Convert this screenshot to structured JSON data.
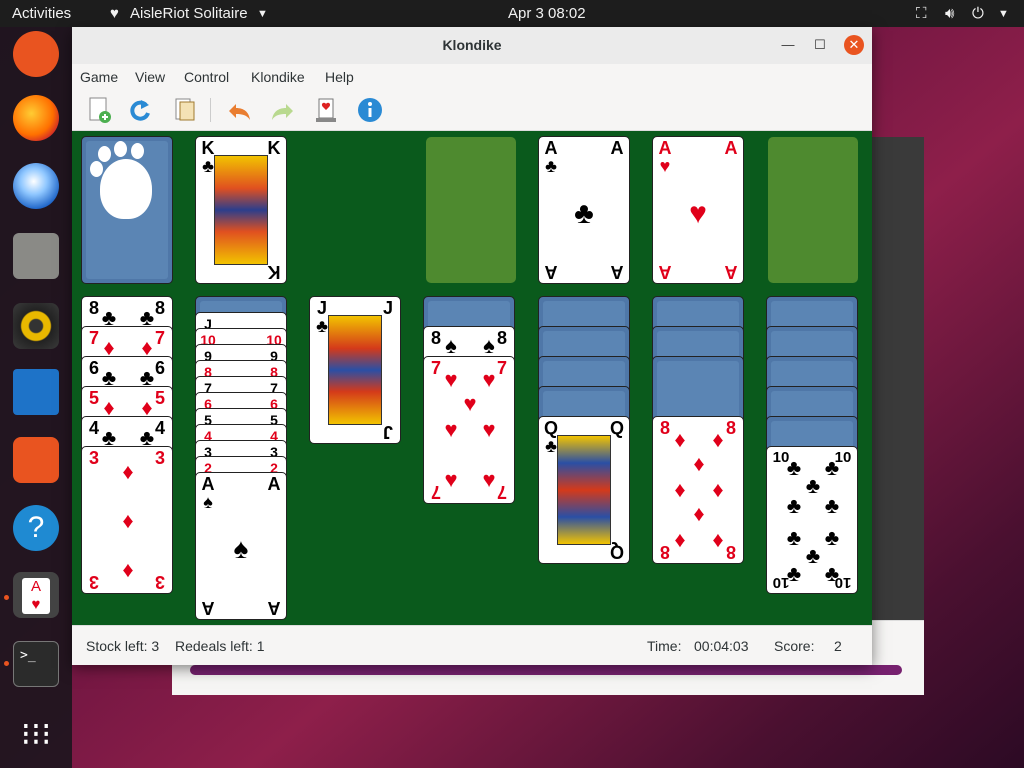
{
  "topbar": {
    "activities": "Activities",
    "app_name": "AisleRiot Solitaire",
    "clock": "Apr 3  08:02"
  },
  "window": {
    "title": "Klondike"
  },
  "menu": [
    "Game",
    "View",
    "Control",
    "Klondike",
    "Help"
  ],
  "toolbar": {
    "icons": [
      "new-game-icon",
      "restart-icon",
      "select-game-icon",
      "undo-icon",
      "redo-icon",
      "hint-icon",
      "info-icon"
    ]
  },
  "cards": {
    "waste": {
      "rank": "K",
      "suit": "♣"
    },
    "foundation_clubs": {
      "rank": "A",
      "suit": "♣"
    },
    "foundation_hearts": {
      "rank": "A",
      "suit": "♥"
    },
    "t1": [
      {
        "rank": "8",
        "suit": "♣"
      },
      {
        "rank": "7",
        "suit": "♦"
      },
      {
        "rank": "6",
        "suit": "♣"
      },
      {
        "rank": "5",
        "suit": "♦"
      },
      {
        "rank": "4",
        "suit": "♣"
      },
      {
        "rank": "3",
        "suit": "♦"
      }
    ],
    "t2_top_rank": "J",
    "t2": [
      {
        "rank": "10",
        "suit": "♦"
      },
      {
        "rank": "9",
        "suit": "♣"
      },
      {
        "rank": "8",
        "suit": "♦"
      },
      {
        "rank": "7",
        "suit": "♣"
      },
      {
        "rank": "6",
        "suit": "♦"
      },
      {
        "rank": "5",
        "suit": "♣"
      },
      {
        "rank": "4",
        "suit": "♦"
      },
      {
        "rank": "3",
        "suit": "♣"
      },
      {
        "rank": "2",
        "suit": "♦"
      }
    ],
    "t2_last": {
      "rank": "A",
      "suit": "♠"
    },
    "t3": {
      "rank": "J",
      "suit": "♣"
    },
    "t4_under": {
      "rank": "8",
      "suit": "♠"
    },
    "t4": {
      "rank": "7",
      "suit": "♥"
    },
    "t5": {
      "rank": "Q",
      "suit": "♣"
    },
    "t6": {
      "rank": "8",
      "suit": "♦"
    },
    "t7": {
      "rank": "10",
      "suit": "♣"
    }
  },
  "status": {
    "stock": "Stock left: 3",
    "redeals": "Redeals left: 1",
    "time_label": "Time:",
    "time_value": "00:04:03",
    "score_label": "Score:",
    "score_value": "2"
  },
  "colors": {
    "felt": "#0a5a1c",
    "slot": "#4e8a2f",
    "card_back": "#5b85b4",
    "ubuntu_orange": "#e95420",
    "red_suit": "#e0001a"
  }
}
